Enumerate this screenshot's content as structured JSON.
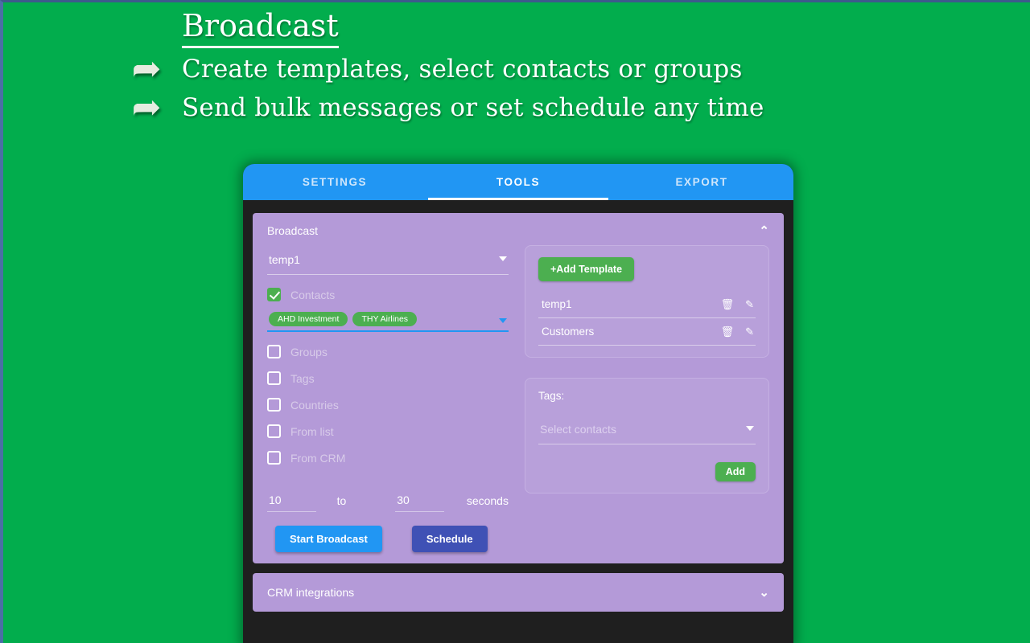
{
  "promo": {
    "title": "Broadcast",
    "arrow_icon": "➦",
    "bullets": [
      "Create templates, select contacts or groups",
      "Send bulk messages or set schedule any time"
    ]
  },
  "colors": {
    "background_green": "#02ad4d",
    "tab_blue": "#2196f3",
    "panel_purple": "#b49ad8",
    "accent_green": "#4caf50",
    "schedule_indigo": "#3f51b5",
    "window_dark": "#1f1f1f"
  },
  "tabs": [
    {
      "label": "SETTINGS",
      "active": false
    },
    {
      "label": "TOOLS",
      "active": true
    },
    {
      "label": "EXPORT",
      "active": false
    }
  ],
  "broadcast_panel": {
    "title": "Broadcast",
    "chevron": "⌃",
    "template_select": {
      "value": "temp1",
      "caret_icon": "chevron-down-icon"
    },
    "options": [
      {
        "label": "Contacts",
        "checked": true
      },
      {
        "label": "Groups",
        "checked": false
      },
      {
        "label": "Tags",
        "checked": false
      },
      {
        "label": "Countries",
        "checked": false
      },
      {
        "label": "From list",
        "checked": false
      },
      {
        "label": "From CRM",
        "checked": false
      }
    ],
    "contact_chips": [
      "AHD Investment",
      "THY Airlines"
    ],
    "delay": {
      "min": "10",
      "word_to": "to",
      "max": "30",
      "unit": "seconds"
    },
    "start_button": "Start Broadcast",
    "schedule_button": "Schedule"
  },
  "templates_panel": {
    "add_button": "+Add Template",
    "rows": [
      {
        "name": "temp1",
        "delete_icon": "🗑",
        "edit_icon": "✎"
      },
      {
        "name": "Customers",
        "delete_icon": "🗑",
        "edit_icon": "✎"
      }
    ]
  },
  "tags_panel": {
    "label": "Tags:",
    "select_placeholder": "Select contacts",
    "add_button": "Add"
  },
  "crm_panel": {
    "title": "CRM integrations",
    "chevron": "⌄"
  }
}
